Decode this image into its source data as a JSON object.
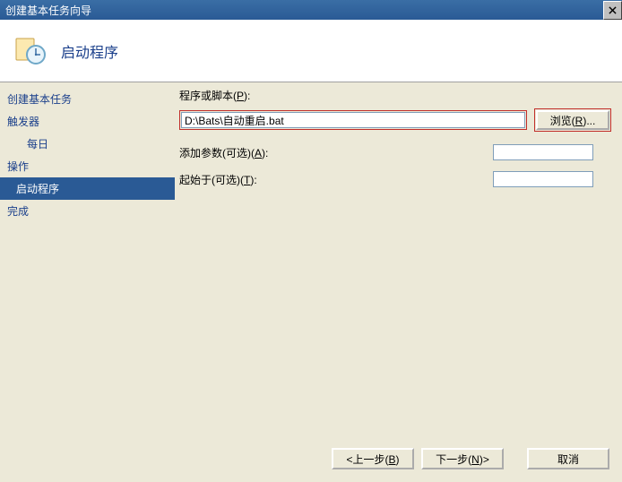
{
  "window": {
    "title": "创建基本任务向导"
  },
  "header": {
    "title": "启动程序"
  },
  "steps": {
    "create": "创建基本任务",
    "trigger": "触发器",
    "daily": "每日",
    "action": "操作",
    "start_program": "启动程序",
    "finish": "完成"
  },
  "form": {
    "script_label_prefix": "程序或脚本(",
    "script_label_key": "P",
    "script_label_suffix": "):",
    "script_value": "D:\\Bats\\自动重启.bat",
    "browse_prefix": "浏览(",
    "browse_key": "R",
    "browse_suffix": ")...",
    "args_label_prefix": "添加参数(可选)(",
    "args_label_key": "A",
    "args_label_suffix": "):",
    "args_value": "",
    "startin_label_prefix": "起始于(可选)(",
    "startin_label_key": "T",
    "startin_label_suffix": "):",
    "startin_value": ""
  },
  "footer": {
    "back_prefix": "<上一步(",
    "back_key": "B",
    "back_suffix": ")",
    "next_prefix": "下一步(",
    "next_key": "N",
    "next_suffix": ")>",
    "cancel": "取消"
  }
}
